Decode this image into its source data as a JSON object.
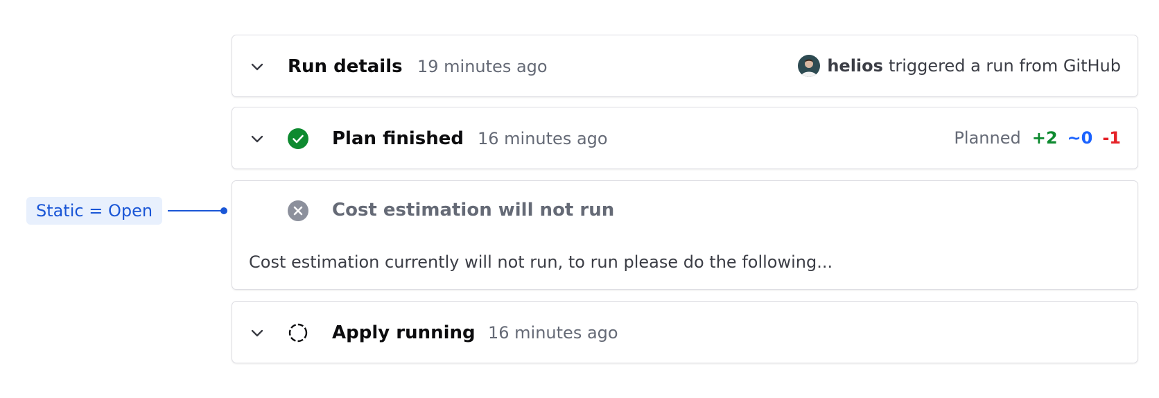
{
  "annotation": {
    "label": "Static = Open"
  },
  "run_details": {
    "title": "Run details",
    "time": "19 minutes ago",
    "user": "helios",
    "trigger_text": "triggered a run from GitHub"
  },
  "plan": {
    "title": "Plan finished",
    "time": "16 minutes ago",
    "planned_label": "Planned",
    "add": "+2",
    "change": "~0",
    "destroy": "-1",
    "status_icon": "check-circle-icon"
  },
  "cost": {
    "title": "Cost estimation will not run",
    "body": "Cost estimation currently will not run, to run please do the following...",
    "status_icon": "x-circle-icon"
  },
  "apply": {
    "title": "Apply running",
    "time": "16 minutes ago",
    "status_icon": "loading-icon"
  },
  "colors": {
    "success": "#0e8a30",
    "highlight": "#1a62ff",
    "danger": "#e52228",
    "muted": "#656a76",
    "annotation": "#1a56d6"
  }
}
